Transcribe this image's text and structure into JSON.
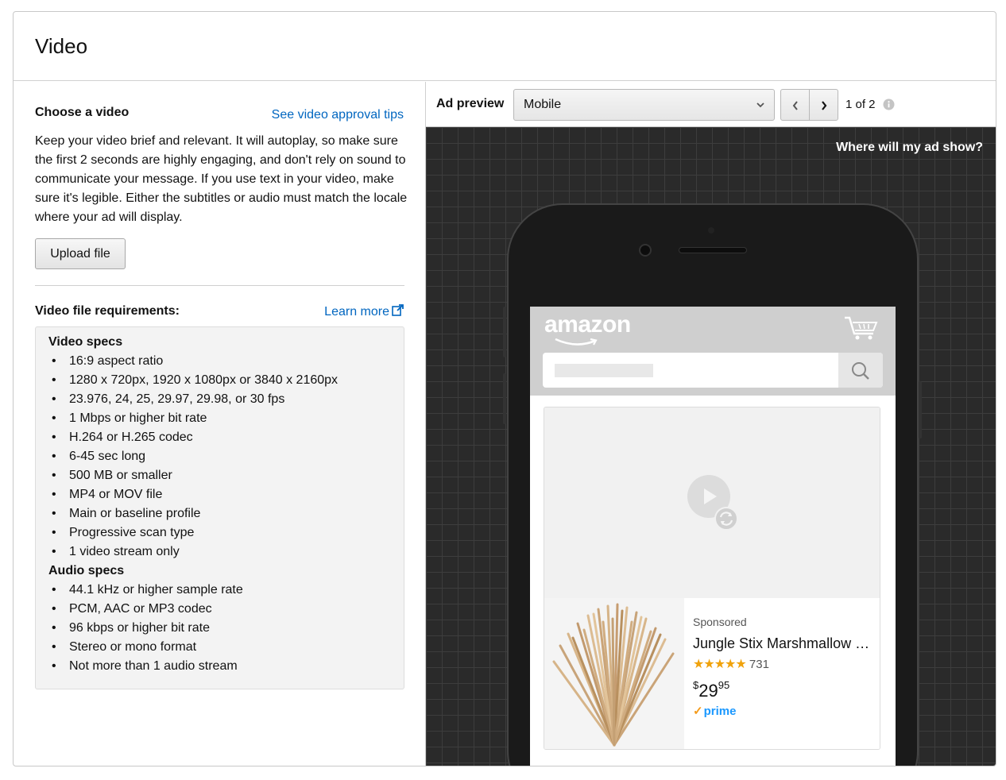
{
  "header": {
    "title": "Video"
  },
  "left": {
    "choose_title": "Choose a video",
    "tips_link": "See video approval tips",
    "description": "Keep your video brief and relevant. It will autoplay, so make sure the first 2 seconds are highly engaging, and don't rely on sound to communicate your message. If you use text in your video, make sure it's legible. Either the subtitles or audio must match the locale where your ad will display.",
    "upload_label": "Upload file",
    "requirements_title": "Video file requirements:",
    "learn_more": "Learn more",
    "video_specs_title": "Video specs",
    "video_specs": [
      "16:9 aspect ratio",
      "1280 x 720px, 1920 x 1080px or 3840 x 2160px",
      "23.976, 24, 25, 29.97, 29.98, or 30 fps",
      "1 Mbps or higher bit rate",
      "H.264 or H.265 codec",
      "6-45 sec long",
      "500 MB or smaller",
      "MP4 or MOV file",
      "Main or baseline profile",
      "Progressive scan type",
      "1 video stream only"
    ],
    "audio_specs_title": "Audio specs",
    "audio_specs": [
      "44.1 kHz or higher sample rate",
      "PCM, AAC or MP3 codec",
      "96 kbps or higher bit rate",
      "Stereo or mono format",
      "Not more than 1 audio stream"
    ]
  },
  "preview": {
    "label": "Ad preview",
    "device_selected": "Mobile",
    "pager_text": "1 of 2",
    "where_link": "Where will my ad show?",
    "brand_logo": "amazon",
    "product": {
      "sponsored": "Sponsored",
      "title": "Jungle Stix Marshmallow S'Mores Roasting Sticks ...",
      "stars": "★★★★★",
      "rating_count": "731",
      "price_currency": "$",
      "price_whole": "29",
      "price_fraction": "95",
      "prime_check": "✓",
      "prime_label": "prime"
    }
  },
  "colors": {
    "link": "#0066c0",
    "star": "#f0a20b",
    "prime": "#1a98ff",
    "stage_bg": "#2a2a2a"
  }
}
